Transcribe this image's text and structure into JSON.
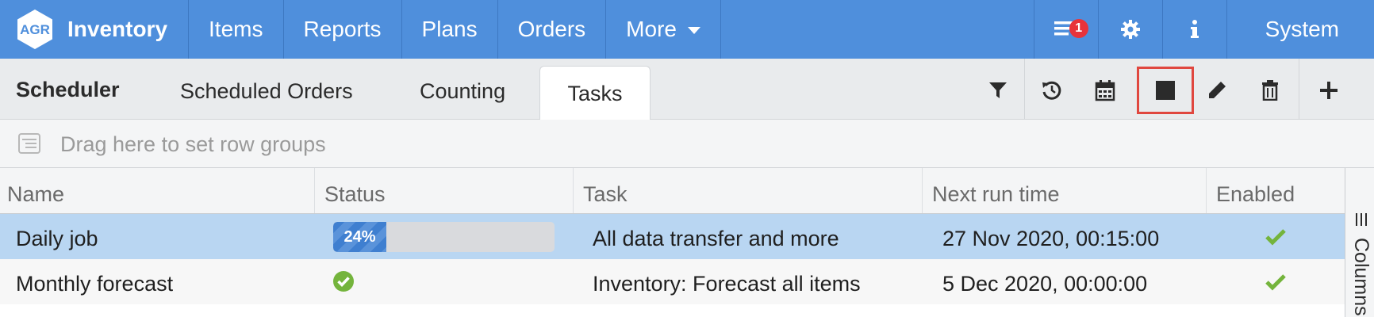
{
  "brand": {
    "logo_text": "AGR",
    "app_name": "Inventory"
  },
  "nav": {
    "items": [
      {
        "label": "Items"
      },
      {
        "label": "Reports"
      },
      {
        "label": "Plans"
      },
      {
        "label": "Orders"
      },
      {
        "label": "More"
      }
    ],
    "notification_count": "1",
    "system_label": "System",
    "icons": [
      "notifications-list-icon",
      "gear-icon",
      "info-icon"
    ]
  },
  "tabbar": {
    "section_title": "Scheduler",
    "tabs": [
      {
        "label": "Scheduled Orders"
      },
      {
        "label": "Counting"
      },
      {
        "label": "Tasks",
        "active": true
      }
    ],
    "tools": [
      "filter-icon",
      "history-icon",
      "calendar-icon",
      "stop-icon",
      "edit-icon",
      "trash-icon",
      "plus-icon"
    ]
  },
  "groupbar": {
    "placeholder": "Drag here to set row groups"
  },
  "grid": {
    "columns": [
      "Name",
      "Status",
      "Task",
      "Next run time",
      "Enabled"
    ],
    "rows": [
      {
        "name": "Daily job",
        "status_progress": 24,
        "status_text": "24%",
        "task": "All data transfer and more",
        "next_run": "27 Nov 2020, 00:15:00",
        "enabled": true,
        "selected": true
      },
      {
        "name": "Monthly forecast",
        "status_icon": "check-circle-icon",
        "task": "Inventory: Forecast all items",
        "next_run": "5 Dec 2020, 00:00:00",
        "enabled": true,
        "selected": false
      }
    ],
    "side_panel_label": "Columns"
  },
  "colors": {
    "nav_bg": "#4f8fdc",
    "selected_row": "#b9d6f2",
    "success_green": "#74b43c",
    "highlight_red": "#e0473f",
    "badge_red": "#e8333a"
  }
}
